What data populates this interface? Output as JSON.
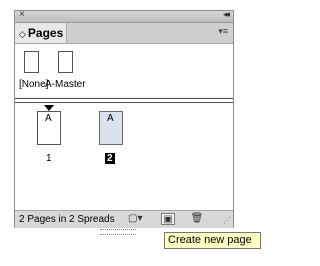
{
  "panel": {
    "close_glyph": "×",
    "collapse_glyph": "◂◂",
    "tab_label": "Pages",
    "tab_arrows": "◇",
    "menu_glyph": "▾≡"
  },
  "masters": [
    {
      "label": "[None]"
    },
    {
      "label": "A-Master"
    }
  ],
  "pages": [
    {
      "prefix": "A",
      "number": "1",
      "selected": false
    },
    {
      "prefix": "A",
      "number": "2",
      "selected": true
    }
  ],
  "status": {
    "text": "2 Pages in 2 Spreads",
    "icons": [
      "edit-page-size-icon",
      "create-new-page-icon",
      "trash-icon"
    ]
  },
  "tooltip": {
    "text": "Create new page"
  }
}
